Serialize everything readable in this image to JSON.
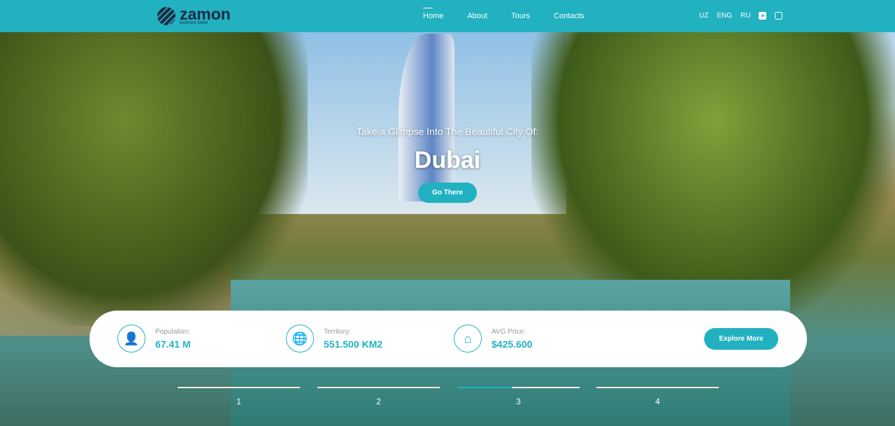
{
  "header": {
    "logo": {
      "name": "zamon",
      "tagline": "business travel"
    },
    "nav": [
      {
        "label": "Home",
        "active": true
      },
      {
        "label": "About"
      },
      {
        "label": "Tours"
      },
      {
        "label": "Contacts"
      }
    ],
    "languages": [
      "UZ",
      "ENG",
      "RU"
    ],
    "social": [
      "telegram-icon",
      "instagram-icon"
    ]
  },
  "hero": {
    "subtitle": "Take a Glimpse Into The Beautiful City Of:",
    "title": "Dubai",
    "button": "Go There"
  },
  "stats": [
    {
      "icon": "user-icon",
      "label": "Population:",
      "value": "67.41 M"
    },
    {
      "icon": "globe-icon",
      "label": "Territory:",
      "value": "551.500 KM2"
    },
    {
      "icon": "home-icon",
      "label": "AVG Price:",
      "value": "$425.600"
    }
  ],
  "explore_button": "Explore More",
  "pager": {
    "items": [
      "1",
      "2",
      "3",
      "4"
    ],
    "active": "3"
  },
  "colors": {
    "accent": "#21b1c1",
    "logo": "#1c2a44"
  }
}
